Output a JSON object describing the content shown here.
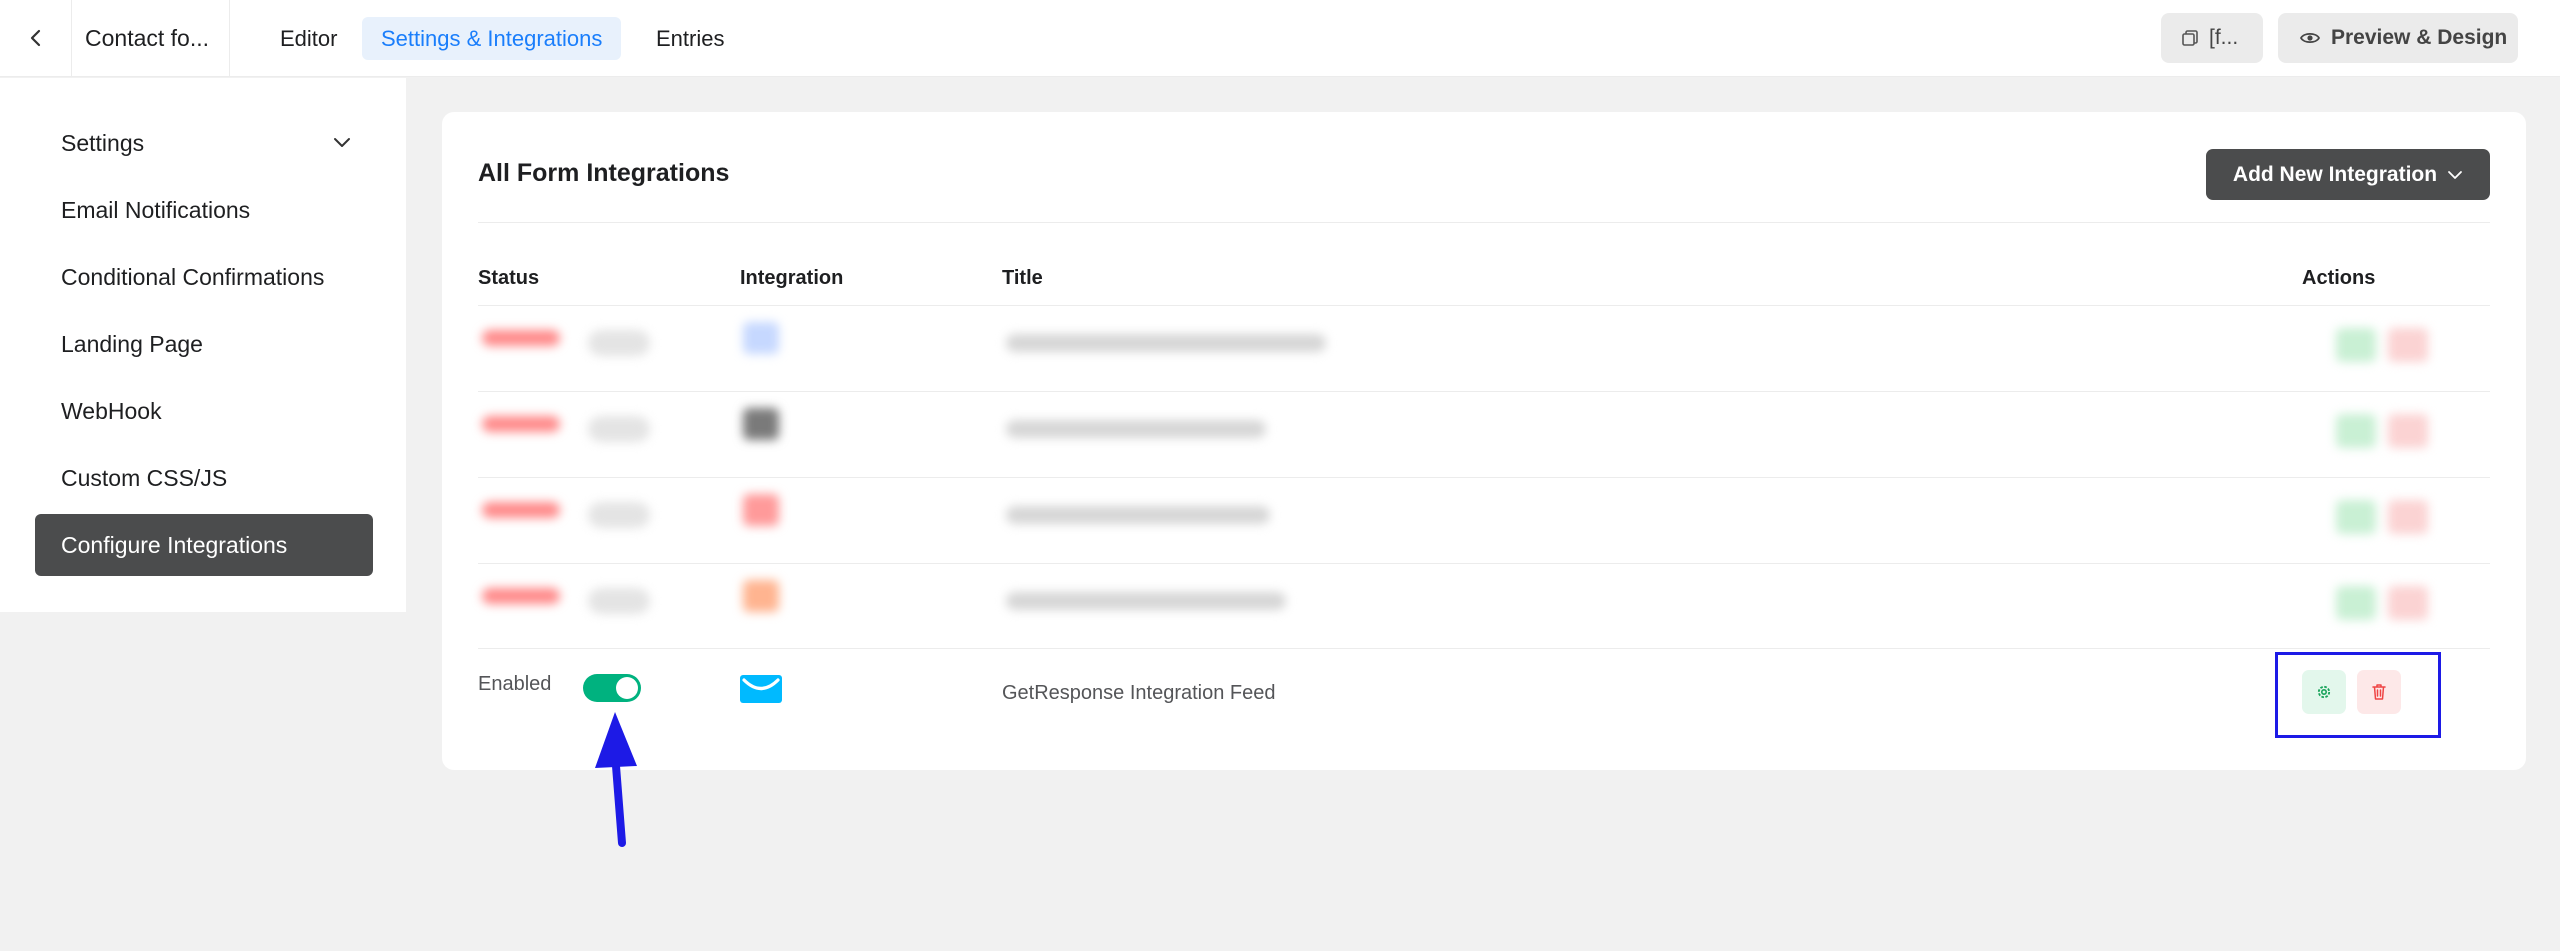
{
  "topbar": {
    "form_name": "Contact fo...",
    "tabs": [
      {
        "label": "Editor"
      },
      {
        "label": "Settings & Integrations"
      },
      {
        "label": "Entries"
      }
    ],
    "shortcode_label": "[f...",
    "preview_label": "Preview & Design"
  },
  "sidebar": {
    "items": [
      {
        "label": "Settings"
      },
      {
        "label": "Email Notifications"
      },
      {
        "label": "Conditional Confirmations"
      },
      {
        "label": "Landing Page"
      },
      {
        "label": "WebHook"
      },
      {
        "label": "Custom CSS/JS"
      },
      {
        "label": "Configure Integrations"
      }
    ]
  },
  "integrations": {
    "title": "All Form Integrations",
    "add_button": "Add New Integration",
    "columns": {
      "status": "Status",
      "integration": "Integration",
      "title": "Title",
      "actions": "Actions"
    },
    "feed": {
      "status": "Enabled",
      "enabled": true,
      "title": "GetResponse Integration Feed",
      "icon": "getresponse-envelope-icon"
    }
  },
  "colors": {
    "accent": "#1a7efb",
    "toggle_on": "#00b27f",
    "dark_button": "#4b4c4d",
    "annotation": "#1d1ae6"
  }
}
